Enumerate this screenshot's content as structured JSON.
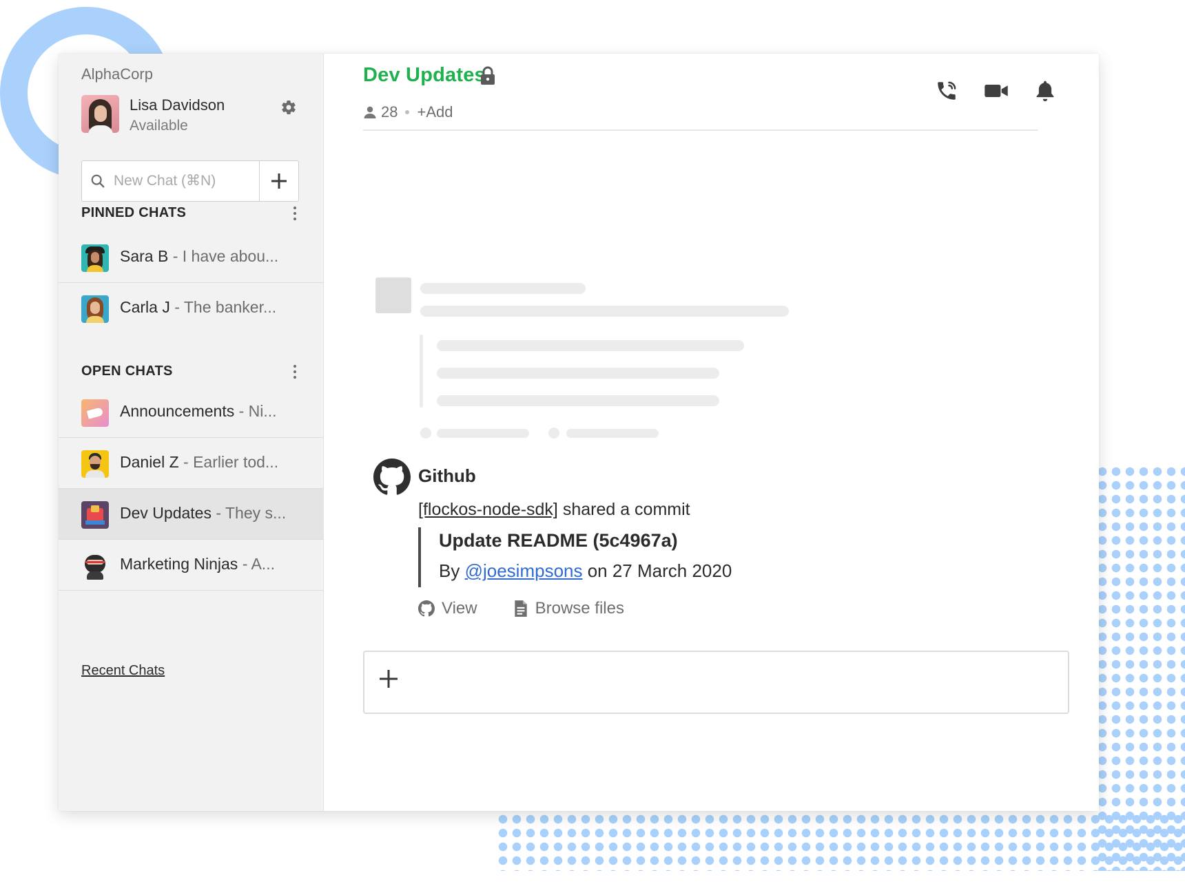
{
  "sidebar": {
    "org": "AlphaCorp",
    "user": {
      "name": "Lisa Davidson",
      "status": "Available"
    },
    "search": {
      "placeholder": "New Chat (⌘N)"
    },
    "pinned": {
      "header": "PINNED CHATS",
      "items": [
        {
          "name": "Sara B",
          "preview": "- I have abou..."
        },
        {
          "name": "Carla J",
          "preview": "- The banker..."
        }
      ]
    },
    "open": {
      "header": "OPEN CHATS",
      "items": [
        {
          "name": "Announcements",
          "preview": "- Ni..."
        },
        {
          "name": "Daniel Z",
          "preview": "- Earlier tod..."
        },
        {
          "name": "Dev Updates",
          "preview": "- They s...",
          "active": true
        },
        {
          "name": "Marketing Ninjas",
          "preview": "- A..."
        }
      ]
    },
    "recent_link": "Recent Chats"
  },
  "channel": {
    "title": "Dev Updates",
    "member_count": "28",
    "add_label": "+Add"
  },
  "message": {
    "sender": "Github",
    "repo": "[flockos-node-sdk]",
    "action": " shared a commit",
    "commit_title": "Update README (5c4967a)",
    "by_prefix": "By ",
    "author": "@joesimpsons",
    "date_text": " on 27 March 2020",
    "view_label": "View",
    "browse_label": "Browse files"
  },
  "colors": {
    "accent_green": "#1fb14d",
    "link_blue": "#2f6bd1",
    "decor_blue": "#a9d1fb"
  },
  "icons": [
    "gear-icon",
    "search-icon",
    "plus-icon",
    "kebab-icon",
    "lock-icon",
    "person-icon",
    "phone-icon",
    "video-icon",
    "bell-icon",
    "github-icon",
    "file-icon"
  ]
}
